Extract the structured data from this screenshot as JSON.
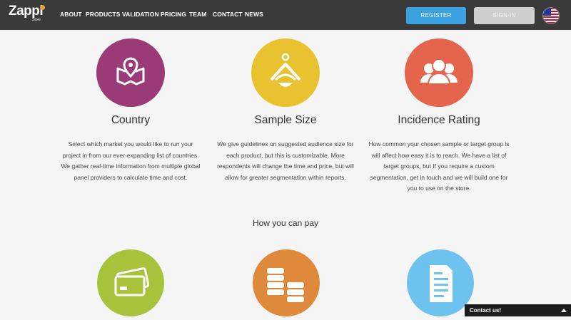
{
  "header": {
    "logo_text": "Zappi",
    "logo_sub": "Store",
    "nav": [
      "ABOUT",
      "PRODUCTS",
      "VALIDATION",
      "PRICING",
      "TEAM",
      "CONTACT",
      "NEWS"
    ],
    "register_label": "REGISTER",
    "signin_label": "SIGN-IN"
  },
  "features": [
    {
      "title": "Country",
      "text": "Select which market you would like to run your project in from our ever-expanding list of countries. We gather real-time information from multiple global panel providers to calculate time and cost.",
      "color": "#9a3b78",
      "icon": "map-pin-icon"
    },
    {
      "title": "Sample Size",
      "text": "We give guidelines on suggested audience size for each product, but this is customizable. More respondents will change the time and price, but will allow for greater segmentation within reports.",
      "color": "#e8c22f",
      "icon": "balance-icon"
    },
    {
      "title": "Incidence Rating",
      "text": "How common your chosen sample or target group is will affect how easy it is to reach. We have a list of target groups, but If you require a custom segmentation, get in touch and we will build one for you to use on the store.",
      "color": "#e5654c",
      "icon": "people-icon"
    }
  ],
  "pay": {
    "title": "How you can pay",
    "items": [
      {
        "icon": "credit-card-icon",
        "color": "#a6c33b"
      },
      {
        "icon": "coins-icon",
        "color": "#df8a3b"
      },
      {
        "icon": "invoice-icon",
        "color": "#6ec2ee"
      }
    ]
  },
  "contact_label": "Contact us!"
}
